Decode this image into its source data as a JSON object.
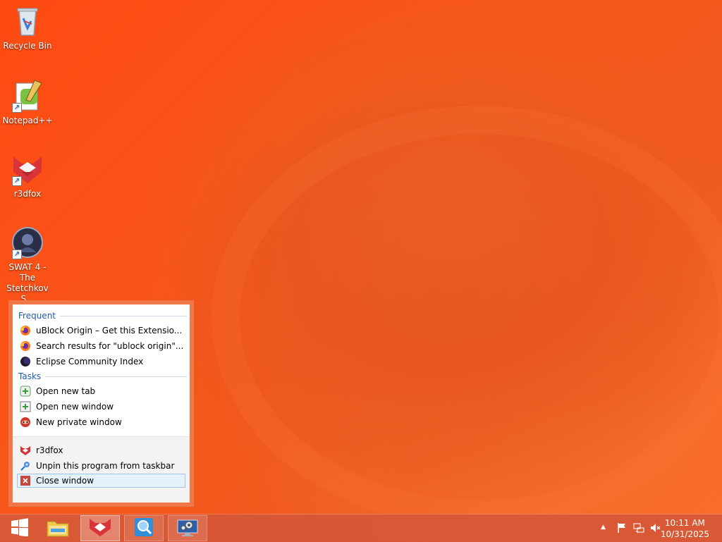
{
  "desktop": {
    "icons": [
      {
        "label": "Recycle Bin"
      },
      {
        "label": "Notepad++"
      },
      {
        "label": "r3dfox"
      },
      {
        "label": "SWAT 4 - The Stetchkov S..."
      }
    ]
  },
  "jumplist": {
    "frequent_title": "Frequent",
    "frequent": [
      {
        "label": "uBlock Origin – Get this Extensio...",
        "icon": "firefox-icon"
      },
      {
        "label": "Search results for \"ublock origin\"...",
        "icon": "firefox-icon"
      },
      {
        "label": "Eclipse Community Index",
        "icon": "eclipse-icon"
      }
    ],
    "tasks_title": "Tasks",
    "tasks": [
      {
        "label": "Open new tab",
        "icon": "new-tab-icon"
      },
      {
        "label": "Open new window",
        "icon": "new-window-icon"
      },
      {
        "label": "New private window",
        "icon": "private-window-icon"
      }
    ],
    "footer": [
      {
        "label": "r3dfox",
        "icon": "r3dfox-icon"
      },
      {
        "label": "Unpin this program from taskbar",
        "icon": "unpin-icon"
      },
      {
        "label": "Close window",
        "icon": "close-icon"
      }
    ]
  },
  "taskbar": {
    "clock_time": "10:11 AM",
    "clock_date": "10/31/2025"
  },
  "colors": {
    "accent": "#1e5bab",
    "taskbar": "#d65837",
    "jumplist_frame": "#f07848"
  }
}
